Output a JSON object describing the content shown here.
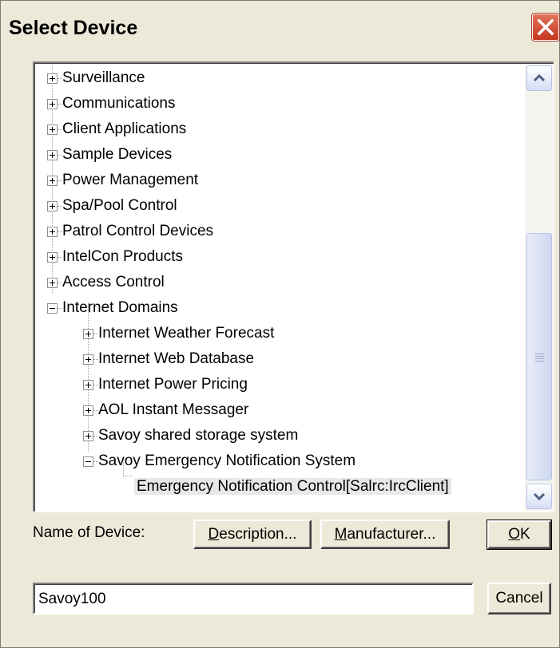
{
  "window": {
    "title": "Select Device",
    "close_icon": "close-x-icon"
  },
  "tree": {
    "items": [
      {
        "label": "Surveillance",
        "expanded": false,
        "level": 0
      },
      {
        "label": "Communications",
        "expanded": false,
        "level": 0
      },
      {
        "label": "Client Applications",
        "expanded": false,
        "level": 0
      },
      {
        "label": "Sample Devices",
        "expanded": false,
        "level": 0
      },
      {
        "label": "Power Management",
        "expanded": false,
        "level": 0
      },
      {
        "label": "Spa/Pool Control",
        "expanded": false,
        "level": 0
      },
      {
        "label": "Patrol Control Devices",
        "expanded": false,
        "level": 0
      },
      {
        "label": "IntelCon Products",
        "expanded": false,
        "level": 0
      },
      {
        "label": "Access Control",
        "expanded": false,
        "level": 0
      },
      {
        "label": "Internet Domains",
        "expanded": true,
        "level": 0
      },
      {
        "label": "Internet Weather Forecast",
        "expanded": false,
        "level": 1
      },
      {
        "label": "Internet Web Database",
        "expanded": false,
        "level": 1
      },
      {
        "label": "Internet Power Pricing",
        "expanded": false,
        "level": 1
      },
      {
        "label": "AOL Instant Messager",
        "expanded": false,
        "level": 1
      },
      {
        "label": "Savoy shared storage system",
        "expanded": false,
        "level": 1
      },
      {
        "label": "Savoy Emergency Notification System",
        "expanded": true,
        "level": 1
      },
      {
        "label": "Emergency Notification Control[Salrc:IrcClient]",
        "leaf": true,
        "selected": true,
        "level": 2
      }
    ],
    "scrollbar": {
      "up_icon": "chevron-up-icon",
      "down_icon": "chevron-down-icon"
    }
  },
  "form": {
    "name_label": "Name of Device:",
    "name_value": "Savoy100",
    "description_button": {
      "underlined": "D",
      "rest": "escription..."
    },
    "manufacturer_button": {
      "underlined": "M",
      "rest": "anufacturer..."
    },
    "ok_button": {
      "underlined": "O",
      "rest": "K"
    },
    "cancel_button": "Cancel"
  },
  "colors": {
    "dialog_bg": "#ece9d8",
    "close_button": "#d9533a",
    "selection": "#e8e8e8"
  }
}
